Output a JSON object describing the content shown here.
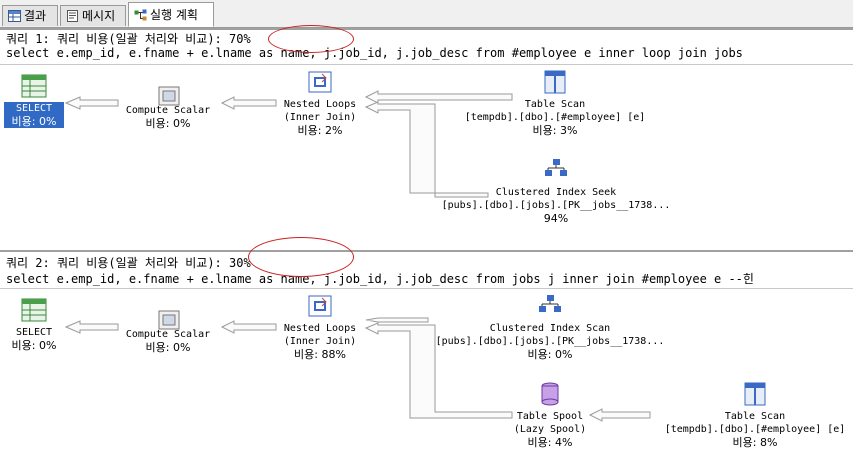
{
  "tabs": [
    {
      "label": "결과",
      "icon": "grid-icon"
    },
    {
      "label": "메시지",
      "icon": "message-icon"
    },
    {
      "label": "실행 계획",
      "icon": "plan-icon"
    }
  ],
  "query1": {
    "header": "쿼리 1: 쿼리 비용(일괄 처리와 비교): 70%",
    "sql": "select e.emp_id, e.fname + e.lname as name, j.job_id, j.job_desc from #employee e inner loop join jobs",
    "nodes": {
      "select": {
        "name": "SELECT",
        "cost": "비용: 0%"
      },
      "compute": {
        "name": "Compute Scalar",
        "cost": "비용: 0%"
      },
      "nested": {
        "name": "Nested Loops",
        "sub": "(Inner Join)",
        "cost": "비용: 2%"
      },
      "tscan": {
        "name": "Table Scan",
        "sub": "[tempdb].[dbo].[#employee] [e]",
        "cost": "비용: 3%"
      },
      "cis": {
        "name": "Clustered Index Seek",
        "sub": "[pubs].[dbo].[jobs].[PK__jobs__1738...",
        "cost": "94%"
      }
    }
  },
  "query2": {
    "header": "쿼리 2: 쿼리 비용(일괄 처리와 비교): 30%",
    "sql": "select e.emp_id, e.fname + e.lname as name, j.job_id, j.job_desc from jobs j inner join #employee e --힌",
    "nodes": {
      "select": {
        "name": "SELECT",
        "cost": "비용: 0%"
      },
      "compute": {
        "name": "Compute Scalar",
        "cost": "비용: 0%"
      },
      "nested": {
        "name": "Nested Loops",
        "sub": "(Inner Join)",
        "cost": "비용: 88%"
      },
      "cis": {
        "name": "Clustered Index Scan",
        "sub": "[pubs].[dbo].[jobs].[PK__jobs__1738...",
        "cost": "비용: 0%"
      },
      "spool": {
        "name": "Table Spool",
        "sub": "(Lazy Spool)",
        "cost": "비용: 4%"
      },
      "tscan": {
        "name": "Table Scan",
        "sub": "[tempdb].[dbo].[#employee] [e]",
        "cost": "비용: 8%"
      }
    }
  }
}
